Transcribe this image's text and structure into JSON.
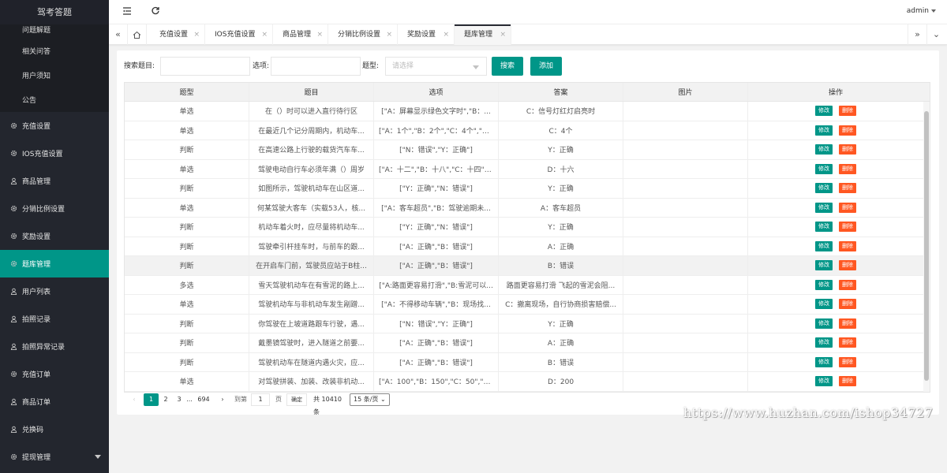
{
  "sidebar": {
    "logo": "驾考答题",
    "sub_items": [
      "问题解题",
      "相关问答",
      "用户须知",
      "公告"
    ],
    "items": [
      {
        "label": "充值设置",
        "icon": "gear-icon"
      },
      {
        "label": "IOS充值设置",
        "icon": "gear-icon"
      },
      {
        "label": "商品管理",
        "icon": "user-icon"
      },
      {
        "label": "分销比例设置",
        "icon": "gear-icon"
      },
      {
        "label": "奖励设置",
        "icon": "gear-icon"
      },
      {
        "label": "题库管理",
        "icon": "gear-icon",
        "active": true
      },
      {
        "label": "用户列表",
        "icon": "user-icon"
      },
      {
        "label": "拍照记录",
        "icon": "user-icon"
      },
      {
        "label": "拍照异常记录",
        "icon": "user-icon"
      },
      {
        "label": "充值订单",
        "icon": "gear-icon"
      },
      {
        "label": "商品订单",
        "icon": "user-icon"
      },
      {
        "label": "兑换码",
        "icon": "user-icon"
      },
      {
        "label": "提现管理",
        "icon": "gear-icon"
      }
    ]
  },
  "header": {
    "menu_toggle_icon": "menu-fold-icon",
    "refresh_icon": "refresh-icon",
    "user": "admin"
  },
  "tabs": [
    {
      "label": "充值设置"
    },
    {
      "label": "IOS充值设置"
    },
    {
      "label": "商品管理"
    },
    {
      "label": "分销比例设置"
    },
    {
      "label": "奖励设置"
    },
    {
      "label": "题库管理",
      "active": true
    }
  ],
  "tabs_close": "×",
  "search": {
    "title_label": "搜索题目:",
    "title_value": "",
    "option_label": "选项:",
    "option_value": "",
    "type_label": "题型:",
    "type_placeholder": "请选择",
    "search_button": "搜索",
    "add_button": "添加"
  },
  "table": {
    "headers": [
      "题型",
      "题目",
      "选项",
      "答案",
      "图片",
      "操作"
    ],
    "edit_label": "修改",
    "delete_label": "删除",
    "rows": [
      {
        "type": "单选",
        "question": "在（）时可以进入直行待行区",
        "options": "[\"A：屏幕显示绿色文字时\",\"B：...",
        "answer": "C：信号灯红灯启亮时",
        "image": ""
      },
      {
        "type": "单选",
        "question": "在最近几个记分周期内，机动车...",
        "options": "[\"A：1个\",\"B：2个\",\"C：4个\",\"D...",
        "answer": "C：4个",
        "image": ""
      },
      {
        "type": "判断",
        "question": "在高速公路上行驶的载货汽车车...",
        "options": "[\"N：错误\",\"Y：正确\"]",
        "answer": "Y：正确",
        "image": ""
      },
      {
        "type": "单选",
        "question": "驾驶电动自行车必须年满（）周岁",
        "options": "[\"A：十二\",\"B：十八\",\"C：十四\",\"...",
        "answer": "D：十六",
        "image": ""
      },
      {
        "type": "判断",
        "question": "如图所示，驾驶机动车在山区道...",
        "options": "[\"Y：正确\",\"N：错误\"]",
        "answer": "Y：正确",
        "image": ""
      },
      {
        "type": "单选",
        "question": "何某驾驶大客车（实载53人，核...",
        "options": "[\"A：客车超员\",\"B：驾驶逾期未...",
        "answer": "A：客车超员",
        "image": ""
      },
      {
        "type": "判断",
        "question": "机动车着火时，应尽量将机动车...",
        "options": "[\"Y：正确\",\"N：错误\"]",
        "answer": "Y：正确",
        "image": ""
      },
      {
        "type": "判断",
        "question": "驾驶牵引杆挂车时，与前车的跟...",
        "options": "[\"A：正确\",\"B：错误\"]",
        "answer": "A：正确",
        "image": ""
      },
      {
        "type": "判断",
        "question": "在开启车门前，驾驶员应站于B柱...",
        "options": "[\"A：正确\",\"B：错误\"]",
        "answer": "B：错误",
        "image": "",
        "highlight": true
      },
      {
        "type": "多选",
        "question": "雪天驾驶机动车在有雪泥的路上...",
        "options": "[\"A:路面更容易打滑\",\"B:雪泥可以...",
        "answer": "路面更容易打滑 飞起的雪泥会阻...",
        "image": ""
      },
      {
        "type": "单选",
        "question": "驾驶机动车与非机动车发生剐蹭...",
        "options": "[\"A：不得移动车辆\",\"B：现场找...",
        "answer": "C：撤离现场，自行协商损害赔偿...",
        "image": ""
      },
      {
        "type": "判断",
        "question": "你驾驶在上坡道路跟车行驶，遇...",
        "options": "[\"N：错误\",\"Y：正确\"]",
        "answer": "Y：正确",
        "image": ""
      },
      {
        "type": "判断",
        "question": "戴墨镜驾驶时，进入隧道之前要...",
        "options": "[\"A：正确\",\"B：错误\"]",
        "answer": "A：正确",
        "image": ""
      },
      {
        "type": "判断",
        "question": "驾驶机动车在隧道内遇火灾，应...",
        "options": "[\"A：正确\",\"B：错误\"]",
        "answer": "B：错误",
        "image": ""
      },
      {
        "type": "单选",
        "question": "对驾驶拼装、加装、改装非机动...",
        "options": "[\"A：100\",\"B：150\",\"C：50\",\"D...",
        "answer": "D：200",
        "image": ""
      }
    ]
  },
  "pager": {
    "prev": "‹",
    "pages": [
      "1",
      "2",
      "3",
      "...",
      "694"
    ],
    "next": "›",
    "goto_label": "到第",
    "goto_value": "1",
    "page_unit": "页",
    "confirm": "确定",
    "total": "共 10410 条",
    "per_page": "15 条/页"
  },
  "watermark": "https://www.huzhan.com/ishop34727"
}
